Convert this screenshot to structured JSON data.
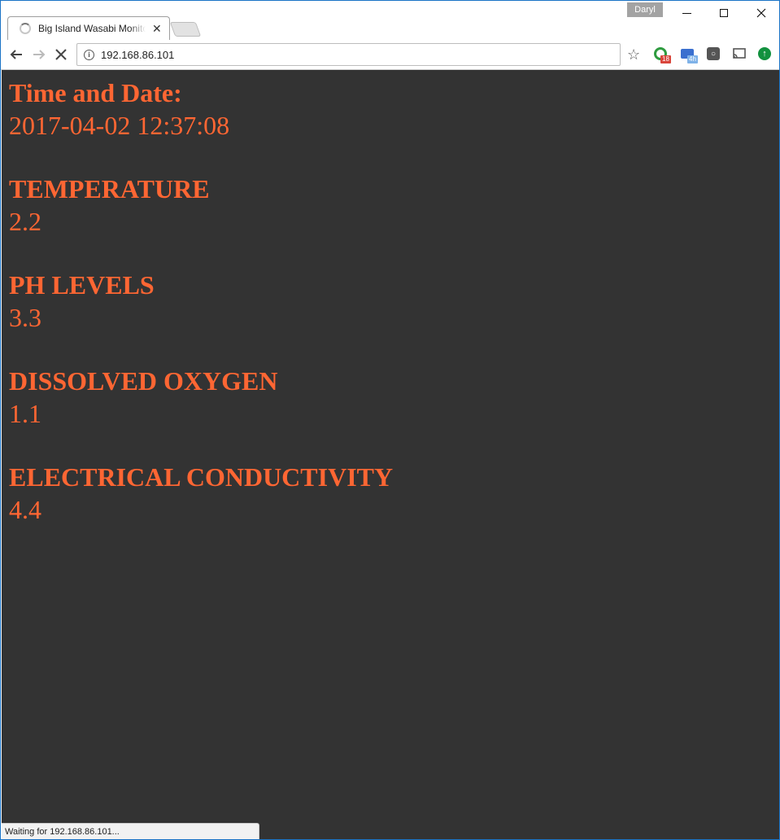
{
  "browser": {
    "tab_title": "Big Island Wasabi Monitor",
    "tab_close": "✕",
    "profile_name": "Daryl",
    "url": "192.168.86.101",
    "status_text": "Waiting for 192.168.86.101...",
    "extensions": [
      {
        "icon": "green-ring-extension-icon",
        "badge": "18"
      },
      {
        "icon": "blue-window-extension-icon",
        "badge": "4h"
      },
      {
        "icon": "bulb-extension-icon"
      },
      {
        "icon": "cast-icon"
      },
      {
        "icon": "green-upload-extension-icon"
      }
    ]
  },
  "page": {
    "background": "#333333",
    "accent": "#ff6633",
    "sections": [
      {
        "label": "Time and Date:",
        "value": "2017-04-02 12:37:08"
      },
      {
        "label": "TEMPERATURE",
        "value": "2.2"
      },
      {
        "label": "PH LEVELS",
        "value": "3.3"
      },
      {
        "label": "DISSOLVED OXYGEN",
        "value": "1.1"
      },
      {
        "label": "ELECTRICAL CONDUCTIVITY",
        "value": "4.4"
      }
    ]
  }
}
